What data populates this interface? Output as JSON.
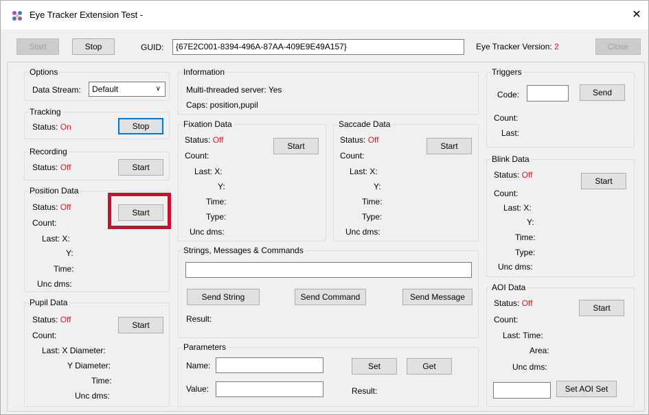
{
  "window": {
    "title": "Eye Tracker Extension Test -"
  },
  "toolbar": {
    "start_label": "Start",
    "stop_label": "Stop",
    "guid_label": "GUID:",
    "guid_value": "{67E2C001-8394-496A-87AA-409E9E49A157}",
    "version_label": "Eye Tracker Version:",
    "version_value": "2",
    "close_label": "Close"
  },
  "options": {
    "title": "Options",
    "data_stream_label": "Data Stream:",
    "data_stream_value": "Default"
  },
  "tracking": {
    "title": "Tracking",
    "status_label": "Status:",
    "status_value": "On",
    "button": "Stop"
  },
  "recording": {
    "title": "Recording",
    "status_label": "Status:",
    "status_value": "Off",
    "button": "Start"
  },
  "position": {
    "title": "Position Data",
    "status_label": "Status:",
    "status_value": "Off",
    "button": "Start",
    "count": "Count:",
    "last_x": "Last:  X:",
    "y": "Y:",
    "time": "Time:",
    "unc": "Unc dms:"
  },
  "pupil": {
    "title": "Pupil Data",
    "status_label": "Status:",
    "status_value": "Off",
    "button": "Start",
    "count": "Count:",
    "last_xd": "Last:  X Diameter:",
    "yd": "Y Diameter:",
    "time": "Time:",
    "unc": "Unc dms:"
  },
  "information": {
    "title": "Information",
    "server": "Multi-threaded server:  Yes",
    "caps": "Caps: position,pupil"
  },
  "fixation": {
    "title": "Fixation Data",
    "status_label": "Status:",
    "status_value": "Off",
    "button": "Start",
    "count": "Count:",
    "last_x": "Last:  X:",
    "y": "Y:",
    "time": "Time:",
    "type": "Type:",
    "unc": "Unc dms:"
  },
  "saccade": {
    "title": "Saccade Data",
    "status_label": "Status:",
    "status_value": "Off",
    "button": "Start",
    "count": "Count:",
    "last_x": "Last:  X:",
    "y": "Y:",
    "time": "Time:",
    "type": "Type:",
    "unc": "Unc dms:"
  },
  "strings": {
    "title": "Strings, Messages & Commands",
    "send_string": "Send String",
    "send_command": "Send Command",
    "send_message": "Send Message",
    "result": "Result:"
  },
  "parameters": {
    "title": "Parameters",
    "name_label": "Name:",
    "value_label": "Value:",
    "set": "Set",
    "get": "Get",
    "result": "Result:"
  },
  "triggers": {
    "title": "Triggers",
    "code_label": "Code:",
    "send": "Send",
    "count": "Count:",
    "last": "Last:"
  },
  "blink": {
    "title": "Blink Data",
    "status_label": "Status:",
    "status_value": "Off",
    "button": "Start",
    "count": "Count:",
    "last_x": "Last:  X:",
    "y": "Y:",
    "time": "Time:",
    "type": "Type:",
    "unc": "Unc dms:"
  },
  "aoi": {
    "title": "AOI Data",
    "status_label": "Status:",
    "status_value": "Off",
    "button": "Start",
    "count": "Count:",
    "last_time": "Last:  Time:",
    "area": "Area:",
    "unc": "Unc dms:",
    "set_aoi": "Set AOI Set"
  },
  "colors": {
    "status_red": "#e81123",
    "highlight": "#c8102e",
    "focus_blue": "#0078d7"
  }
}
